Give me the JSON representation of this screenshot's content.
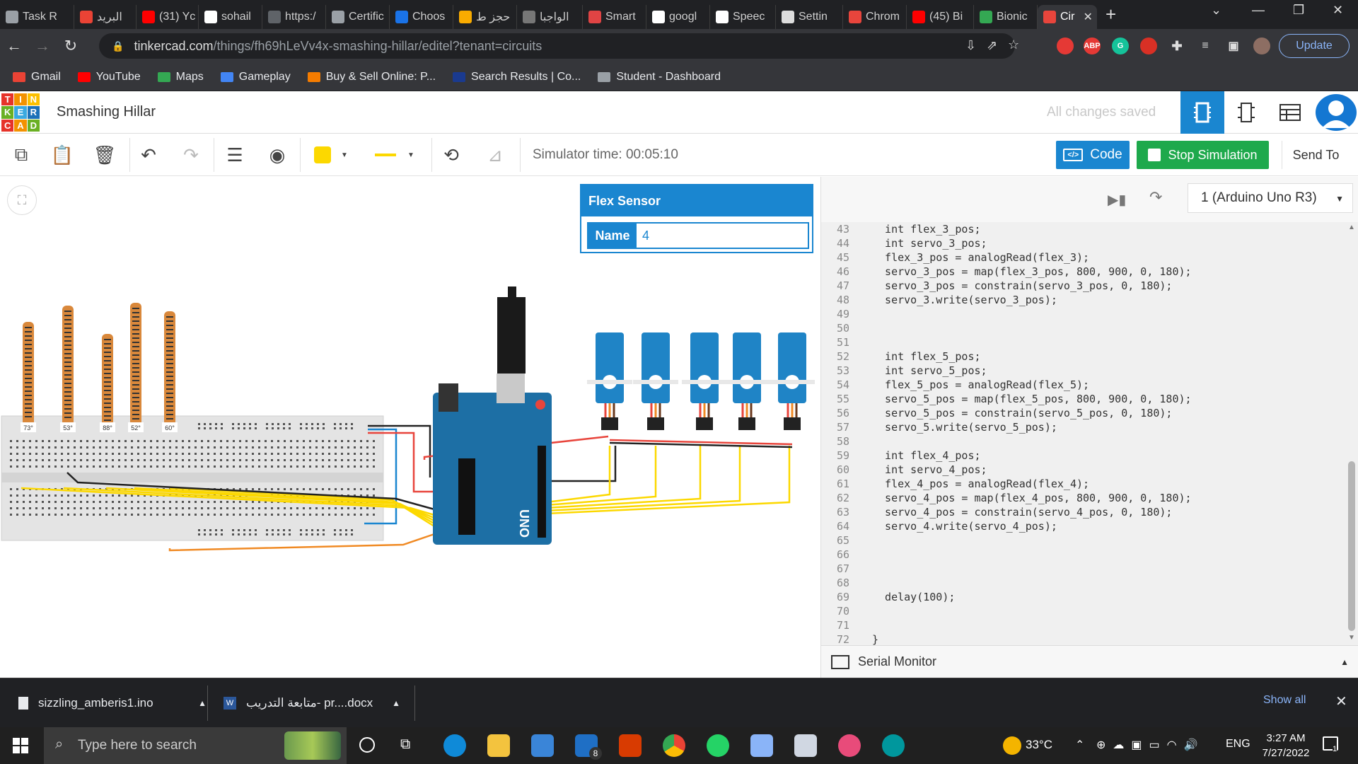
{
  "browser": {
    "tabs": [
      {
        "label": "Task R",
        "color": "#9aa0a6"
      },
      {
        "label": "البريد",
        "color": "#ea4335"
      },
      {
        "label": "(31) Yc",
        "color": "#ff0000"
      },
      {
        "label": "sohail",
        "color": "#ffffff"
      },
      {
        "label": "https:/",
        "color": "#5f6368"
      },
      {
        "label": "Certific",
        "color": "#9aa0a6"
      },
      {
        "label": "Choos",
        "color": "#1a73e8"
      },
      {
        "label": "حجز ط",
        "color": "#f9ab00"
      },
      {
        "label": "الواجبا",
        "color": "#777777"
      },
      {
        "label": "Smart",
        "color": "#e04444"
      },
      {
        "label": "googl",
        "color": "#ffffff"
      },
      {
        "label": "Speec",
        "color": "#ffffff"
      },
      {
        "label": "Settin",
        "color": "#dddddd"
      },
      {
        "label": "Chrom",
        "color": "#e8453c"
      },
      {
        "label": "(45) Bi",
        "color": "#ff0000"
      },
      {
        "label": "Bionic",
        "color": "#34a853"
      },
      {
        "label": "Cir",
        "color": "#e8453c"
      }
    ],
    "url_host": "tinkercad.com",
    "url_path": "/things/fh69hLeVv4x-smashing-hillar/editel?tenant=circuits",
    "update_label": "Update",
    "bookmarks": [
      {
        "label": "Gmail",
        "color": "#ea4335"
      },
      {
        "label": "YouTube",
        "color": "#ff0000"
      },
      {
        "label": "Maps",
        "color": "#34a853"
      },
      {
        "label": "Gameplay",
        "color": "#4285f4"
      },
      {
        "label": "Buy & Sell Online: P...",
        "color": "#f57c00"
      },
      {
        "label": "Search Results | Co...",
        "color": "#1a3a8f"
      },
      {
        "label": "Student - Dashboard",
        "color": "#9aa0a6"
      }
    ]
  },
  "tinkercad": {
    "logo_letters": [
      "T",
      "I",
      "N",
      "K",
      "E",
      "R",
      "C",
      "A",
      "D"
    ],
    "logo_colors": [
      "#e6332a",
      "#f39200",
      "#fcc000",
      "#6ab023",
      "#3aa9e0",
      "#1c71b8",
      "#e6332a",
      "#f39200",
      "#6ab023"
    ],
    "project_name": "Smashing Hillar",
    "save_status": "All changes saved",
    "simulator_time": "Simulator time: 00:05:10",
    "code_label": "Code",
    "stop_label": "Stop Simulation",
    "send_label": "Send To",
    "accent": "#1a86d0",
    "stop_color": "#1ea94c"
  },
  "inspector": {
    "title": "Flex Sensor",
    "name_label": "Name",
    "name_value": "4"
  },
  "circuit": {
    "flex_angles": [
      "73°",
      "53°",
      "88°",
      "52°",
      "60°"
    ],
    "board_label": "UNO"
  },
  "code_panel": {
    "device": "1 (Arduino Uno R3)",
    "serial_monitor": "Serial Monitor",
    "lines": [
      {
        "n": "43",
        "t": "  int flex_3_pos;"
      },
      {
        "n": "44",
        "t": "  int servo_3_pos;"
      },
      {
        "n": "45",
        "t": "  flex_3_pos = analogRead(flex_3);"
      },
      {
        "n": "46",
        "t": "  servo_3_pos = map(flex_3_pos, 800, 900, 0, 180);"
      },
      {
        "n": "47",
        "t": "  servo_3_pos = constrain(servo_3_pos, 0, 180);"
      },
      {
        "n": "48",
        "t": "  servo_3.write(servo_3_pos);"
      },
      {
        "n": "49",
        "t": ""
      },
      {
        "n": "50",
        "t": ""
      },
      {
        "n": "51",
        "t": ""
      },
      {
        "n": "52",
        "t": "  int flex_5_pos;"
      },
      {
        "n": "53",
        "t": "  int servo_5_pos;"
      },
      {
        "n": "54",
        "t": "  flex_5_pos = analogRead(flex_5);"
      },
      {
        "n": "55",
        "t": "  servo_5_pos = map(flex_5_pos, 800, 900, 0, 180);"
      },
      {
        "n": "56",
        "t": "  servo_5_pos = constrain(servo_5_pos, 0, 180);"
      },
      {
        "n": "57",
        "t": "  servo_5.write(servo_5_pos);"
      },
      {
        "n": "58",
        "t": ""
      },
      {
        "n": "59",
        "t": "  int flex_4_pos;"
      },
      {
        "n": "60",
        "t": "  int servo_4_pos;"
      },
      {
        "n": "61",
        "t": "  flex_4_pos = analogRead(flex_4);"
      },
      {
        "n": "62",
        "t": "  servo_4_pos = map(flex_4_pos, 800, 900, 0, 180);"
      },
      {
        "n": "63",
        "t": "  servo_4_pos = constrain(servo_4_pos, 0, 180);"
      },
      {
        "n": "64",
        "t": "  servo_4.write(servo_4_pos);"
      },
      {
        "n": "65",
        "t": ""
      },
      {
        "n": "66",
        "t": ""
      },
      {
        "n": "67",
        "t": ""
      },
      {
        "n": "68",
        "t": ""
      },
      {
        "n": "69",
        "t": "  delay(100);"
      },
      {
        "n": "70",
        "t": ""
      },
      {
        "n": "71",
        "t": ""
      },
      {
        "n": "72",
        "t": "}"
      }
    ]
  },
  "downloads": {
    "items": [
      {
        "name": "sizzling_amberis1.ino",
        "icon": "file-icon"
      },
      {
        "name": "متابعة التدريب- pr....docx",
        "icon": "word-icon"
      }
    ],
    "show_all": "Show all"
  },
  "taskbar": {
    "search_placeholder": "Type here to search",
    "temperature": "33°C",
    "language": "ENG",
    "time": "3:27 AM",
    "date": "7/27/2022",
    "mail_badge": "8",
    "notification_count": "1"
  }
}
